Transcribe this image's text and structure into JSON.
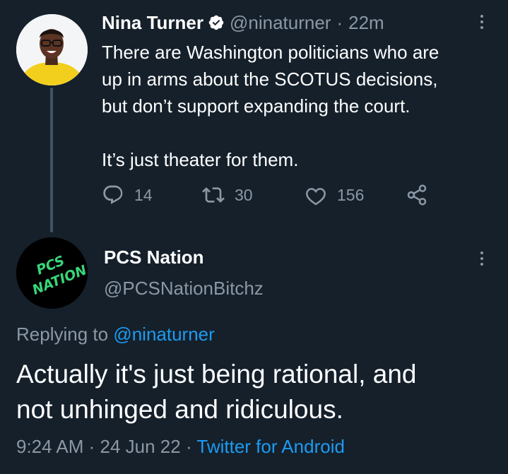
{
  "tweet": {
    "author_name": "Nina Turner",
    "handle": "@ninaturner",
    "separator": "·",
    "time": "22m",
    "lines": [
      "There are Washington politicians who are",
      "up in arms about the SCOTUS decisions,",
      "but don’t support expanding the court.",
      "It’s just theater for them."
    ],
    "replies": "14",
    "retweets": "30",
    "likes": "156"
  },
  "reply": {
    "author_name": "PCS Nation",
    "handle": "@PCSNationBitchz",
    "avatar_text": [
      "PCS",
      "NATION"
    ],
    "replying_prefix": "Replying to",
    "replying_handle": "@ninaturner",
    "text_lines": [
      "Actually it's just being rational, and",
      "not unhinged and ridiculous."
    ],
    "timestamp": "9:24 AM · 24 Jun 22",
    "separator": "·",
    "source": "Twitter for Android"
  },
  "colors": {
    "background": "#15202b",
    "secondary_text": "#8b98a5",
    "link": "#1d9bf0",
    "thread_line": "#3d5466",
    "pcs_green": "#38d67a"
  },
  "icons": [
    "verified-icon",
    "more-icon",
    "reply-icon",
    "retweet-icon",
    "like-icon",
    "share-icon"
  ]
}
